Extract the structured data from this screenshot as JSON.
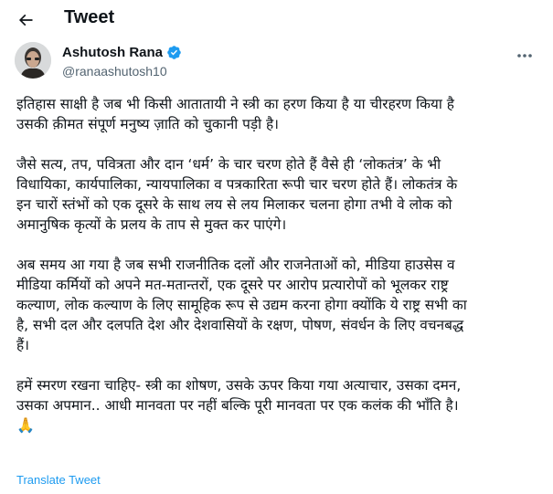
{
  "header": {
    "title": "Tweet"
  },
  "author": {
    "name": "Ashutosh Rana",
    "handle": "@ranaashutosh10"
  },
  "tweet": {
    "paragraphs": [
      "इतिहास साक्षी है जब भी किसी आतातायी ने स्त्री का हरण किया है या चीरहरण किया है\nउसकी क़ीमत संपूर्ण मनुष्य ज़ाति को चुकानी पड़ी है।",
      "जैसे सत्य, तप, पवित्रता और दान ‘धर्म’ के चार चरण होते हैं वैसे ही ‘लोकतंत्र’ के भी\nविधायिका, कार्यपालिका, न्यायपालिका व पत्रकारिता रूपी चार चरण होते हैं। लोकतंत्र के\nइन चारों स्तंभों को एक दूसरे के साथ लय से लय मिलाकर चलना होगा तभी वे लोक को\nअमानुषिक कृत्यों के प्रलय के ताप से मुक्त कर पाएंगे।",
      "अब समय आ गया है जब सभी राजनीतिक दलों और राजनेताओं को, मीडिया हाउसेस व\nमीडिया कर्मियों को अपने मत-मतान्तरों, एक दूसरे पर आरोप प्रत्यारोपों को भूलकर राष्ट्र\nकल्याण, लोक कल्याण के लिए सामूहिक रूप से उद्यम करना होगा क्योंकि ये राष्ट्र सभी का\nहै, सभी दल और दलपति देश और देशवासियों के रक्षण, पोषण, संवर्धन के लिए वचनबद्ध\nहैं।",
      "हमें स्मरण रखना चाहिए- स्त्री का शोषण, उसके ऊपर किया गया अत्याचार, उसका दमन,\nउसका अपमान.. आधी मानवता पर नहीं बल्कि पूरी मानवता पर एक कलंक की भाँति है।"
    ],
    "emoji": "🙏",
    "translate_label": "Translate Tweet"
  },
  "icons": {
    "back": "arrow-left-icon",
    "verified": "verified-badge-icon",
    "more": "more-horizontal-icon"
  },
  "colors": {
    "accent": "#1d9bf0",
    "text": "#0f1419",
    "secondary": "#536471"
  }
}
